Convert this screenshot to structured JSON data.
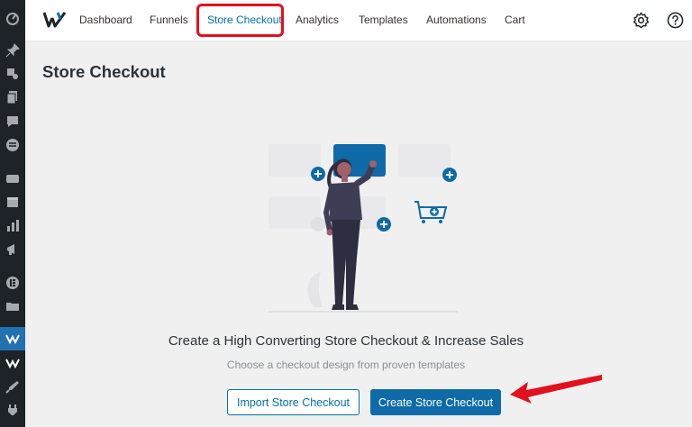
{
  "nav": {
    "items": [
      {
        "label": "Dashboard"
      },
      {
        "label": "Funnels"
      },
      {
        "label": "Store Checkout"
      },
      {
        "label": "Analytics"
      },
      {
        "label": "Templates"
      },
      {
        "label": "Automations"
      },
      {
        "label": "Cart"
      }
    ],
    "active_index": 2,
    "settings_icon": "gear-icon",
    "help_icon": "question-circle-icon"
  },
  "sidebar": {
    "icons": [
      "dashboard-icon",
      "pin-icon",
      "media-icon",
      "pages-icon",
      "comments-icon",
      "woo-icon",
      "woo-badge-icon",
      "products-icon",
      "analytics-icon",
      "marketing-icon",
      "elementor-icon",
      "templates-folder-icon",
      "funnelkit-icon",
      "funnelkit-alt-icon",
      "appearance-icon",
      "plugins-icon"
    ]
  },
  "page": {
    "title": "Store Checkout",
    "headline": "Create a High Converting Store Checkout & Increase Sales",
    "subline": "Choose a checkout design from proven templates",
    "import_label": "Import Store Checkout",
    "create_label": "Create Store Checkout"
  },
  "colors": {
    "accent": "#0073aa",
    "primary_button": "#0e6ba8",
    "annotation_red": "#e3101d",
    "sidebar_bg": "#1d2327"
  }
}
